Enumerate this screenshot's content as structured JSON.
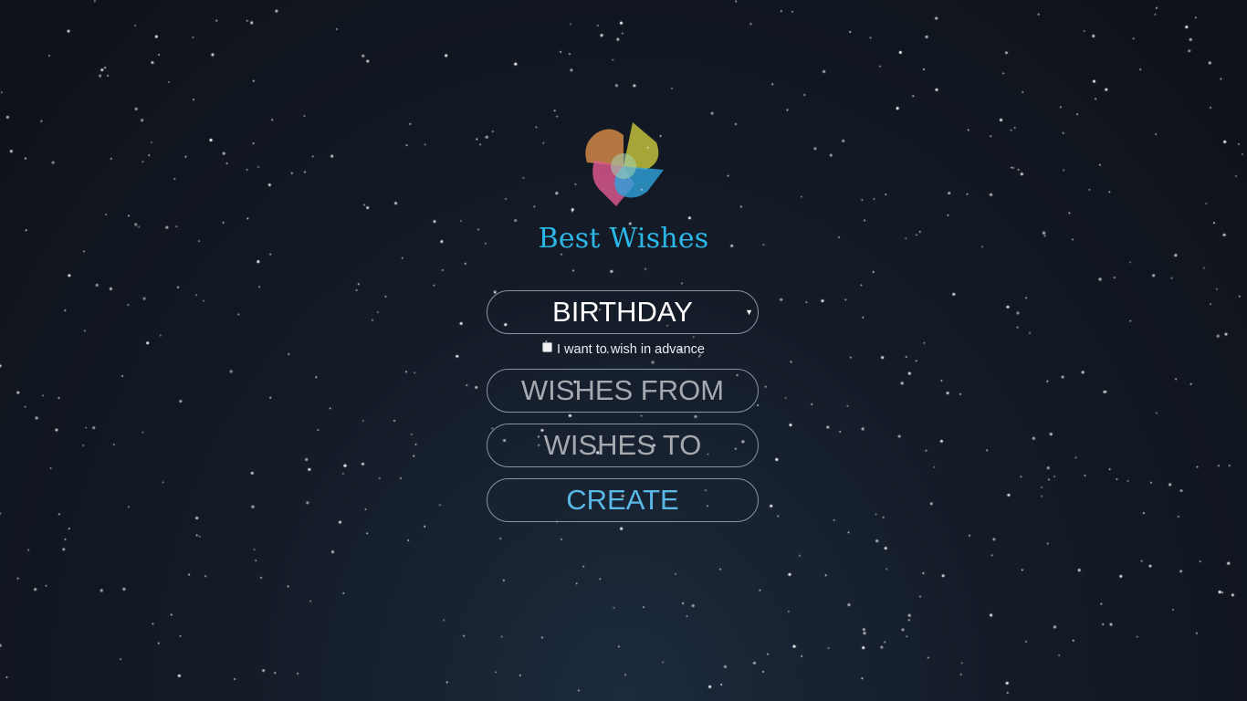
{
  "brand": {
    "title": "Best Wishes",
    "logo_icon": "flower-petals-logo-icon",
    "title_color": "#2bb8e8"
  },
  "form": {
    "occasion": {
      "selected": "BIRTHDAY",
      "caret_icon": "dropdown-caret-icon"
    },
    "advance_checkbox": {
      "label": "I want to wish in advance",
      "checked": false
    },
    "from_field": {
      "placeholder": "WISHES FROM",
      "value": ""
    },
    "to_field": {
      "placeholder": "WISHES TO",
      "value": ""
    },
    "create_button": {
      "label": "CREATE",
      "color": "#5ab8e6"
    }
  },
  "background": {
    "theme": "starry-night",
    "top_color": "#0d1118",
    "bottom_color": "#1c2a3c"
  }
}
